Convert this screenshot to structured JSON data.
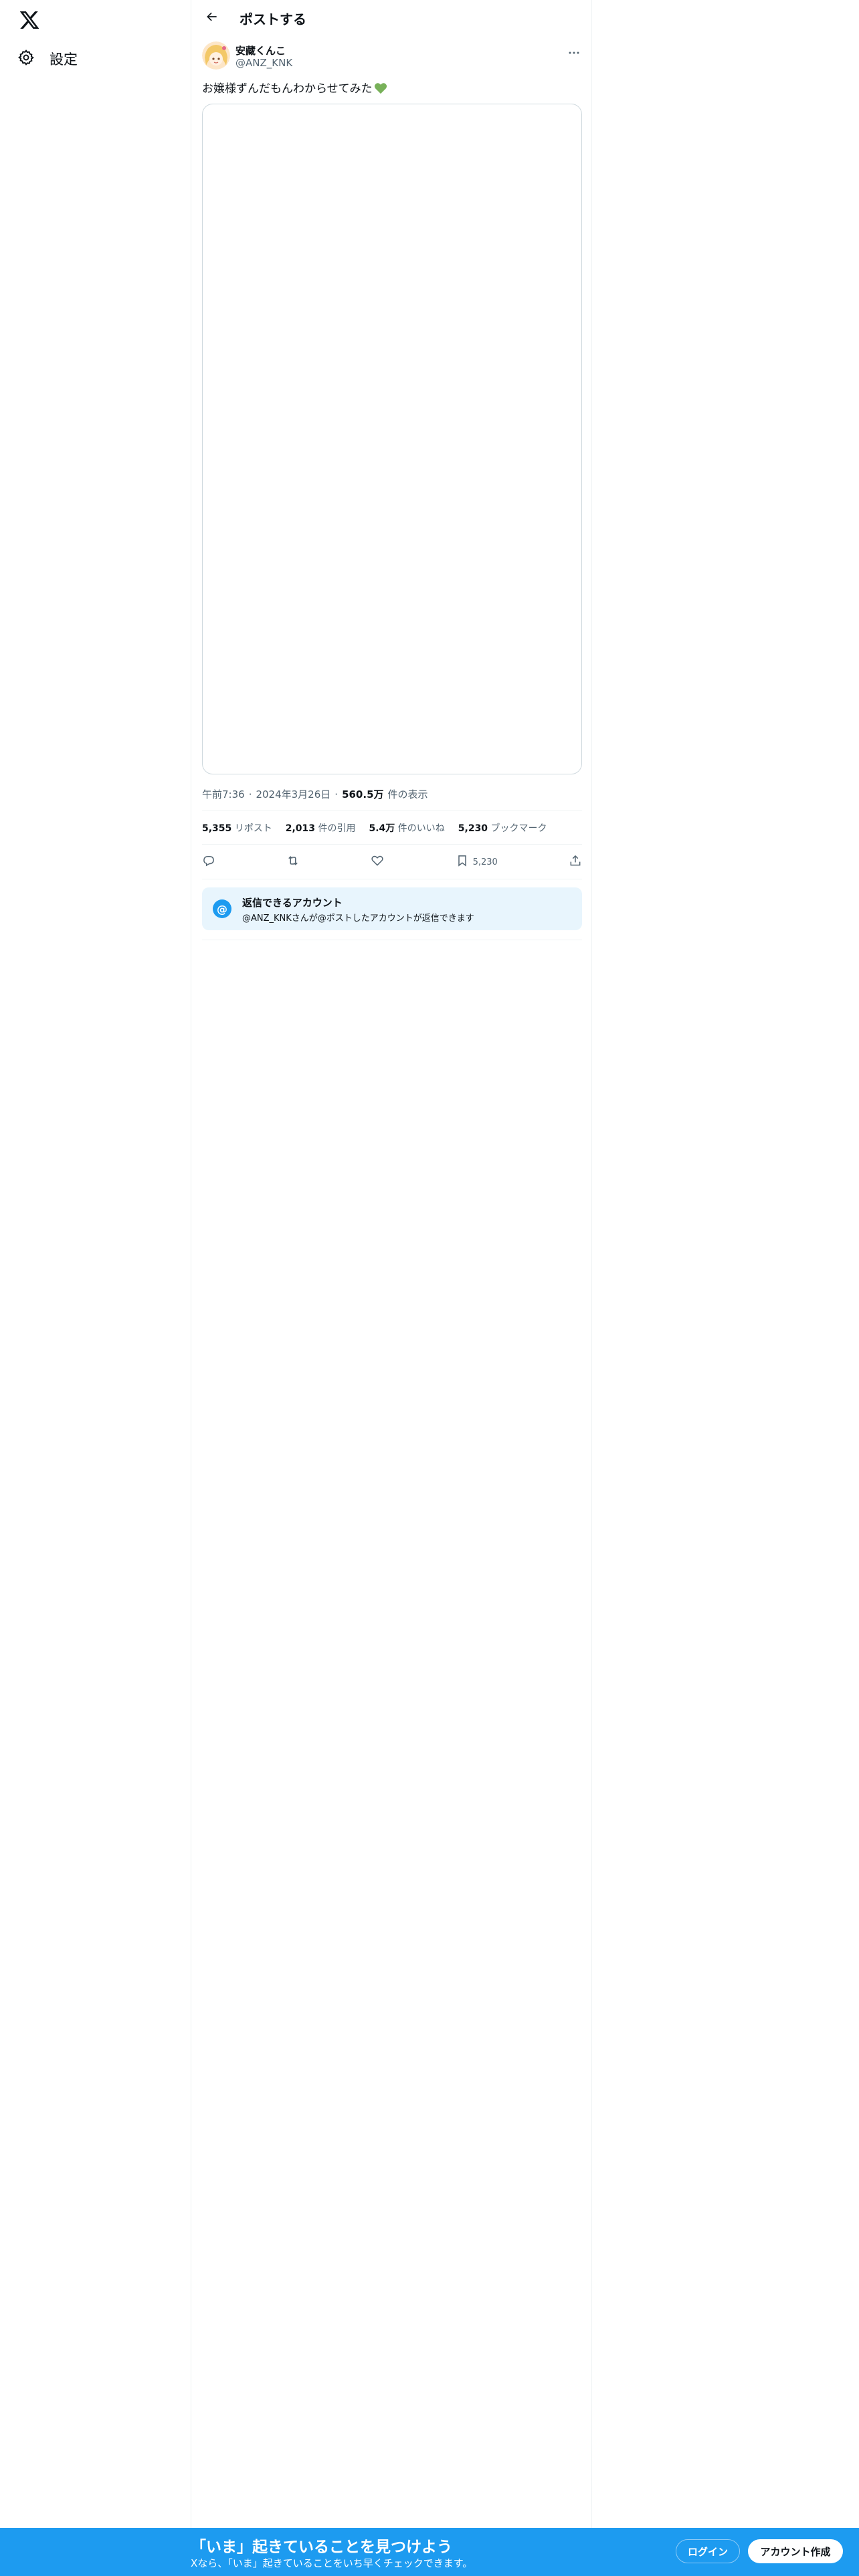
{
  "nav": {
    "logo_icon": "x-logo-icon",
    "settings_icon": "gear-icon",
    "settings_label": "設定"
  },
  "header": {
    "back_icon": "arrow-left-icon",
    "title": "ポストする"
  },
  "post": {
    "author_name": "安藏くんこ",
    "author_handle": "@ANZ_KNK",
    "text": "お嬢様ずんだもんわからせてみた",
    "emoji": "green-heart",
    "time": "午前7:36",
    "date": "2024年3月26日",
    "views": "560.5万",
    "views_label": "件の表示",
    "stats": {
      "reposts": "5,355",
      "reposts_label": "リポスト",
      "quotes": "2,013",
      "quotes_label": "件の引用",
      "likes": "5.4万",
      "likes_label": "件のいいね",
      "bookmarks": "5,230",
      "bookmarks_label": "ブックマーク"
    },
    "actions": {
      "bookmark_count": "5,230"
    }
  },
  "reply_notice": {
    "title": "返信できるアカウント",
    "description": "@ANZ_KNKさんが@ポストしたアカウントが返信できます"
  },
  "bottom_bar": {
    "title": "「いま」起きていることを見つけよう",
    "subtitle": "Xなら、「いま」起きていることをいち早くチェックできます。",
    "login_label": "ログイン",
    "signup_label": "アカウント作成"
  },
  "colors": {
    "accent": "#1d9bf0",
    "text": "#0f1419",
    "secondary": "#536471"
  }
}
